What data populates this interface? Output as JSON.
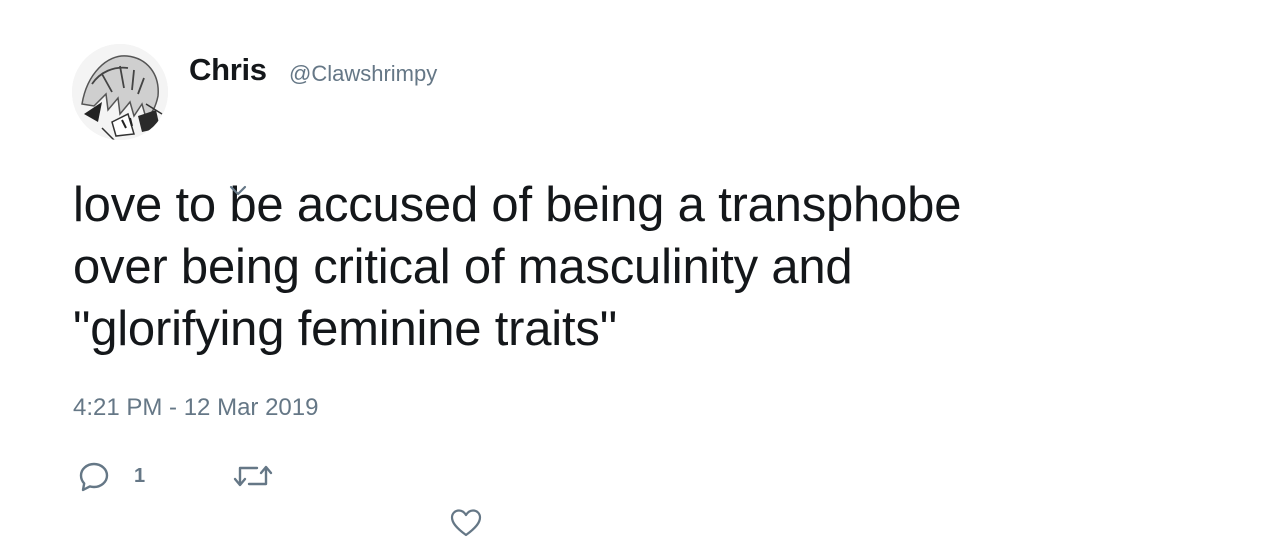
{
  "tweet": {
    "author": {
      "display_name": "Chris",
      "handle": "@Clawshrimpy",
      "avatar_icon": "avatar-image"
    },
    "text_lines": [
      "love to be accused of being a transphobe",
      "over being critical of masculinity and",
      "\"glorifying feminine traits\""
    ],
    "timestamp": "4:21 PM - 12 Mar 2019",
    "actions": {
      "reply": {
        "icon": "reply-icon",
        "count": "1"
      },
      "retweet": {
        "icon": "retweet-icon"
      },
      "like": {
        "icon": "heart-icon"
      }
    },
    "caret_icon": "chevron-down-icon"
  },
  "colors": {
    "text_primary": "#14171a",
    "text_secondary": "#657786",
    "icon": "#657786",
    "background": "#ffffff"
  }
}
